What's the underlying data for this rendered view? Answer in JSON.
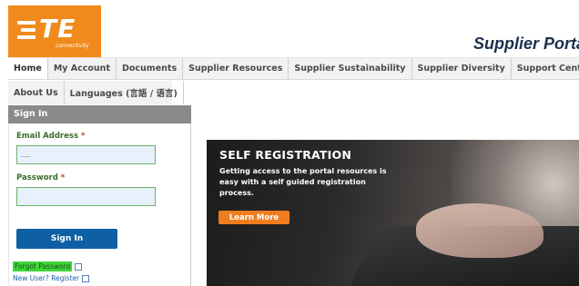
{
  "brand": {
    "logo_text": "TE",
    "logo_subtext": "connectivity",
    "portal_title": "Supplier Portal"
  },
  "nav": {
    "primary": [
      {
        "label": "Home"
      },
      {
        "label": "My Account"
      },
      {
        "label": "Documents"
      },
      {
        "label": "Supplier Resources"
      },
      {
        "label": "Supplier Sustainability"
      },
      {
        "label": "Supplier Diversity"
      },
      {
        "label": "Support Center"
      }
    ],
    "secondary": [
      {
        "label": "About Us"
      },
      {
        "label": "Languages (言語 / 语言)"
      }
    ]
  },
  "signin": {
    "heading": "Sign In",
    "email_label": "Email Address",
    "email_value": "....",
    "password_label": "Password",
    "password_value": "",
    "required_marker": "*",
    "button_label": "Sign In",
    "forgot_link": "Forgot Password",
    "register_link": "New User? Register"
  },
  "promo": {
    "title": "SELF REGISTRATION",
    "text": "Getting access to the portal resources is easy with a self guided registration process.",
    "button_label": "Learn More"
  },
  "colors": {
    "brand_orange": "#f08a1c",
    "nav_bg": "#f2f2f2",
    "signin_button": "#0e5fa4",
    "promo_button": "#f07d1d",
    "forgot_highlight": "#3ed63b"
  }
}
